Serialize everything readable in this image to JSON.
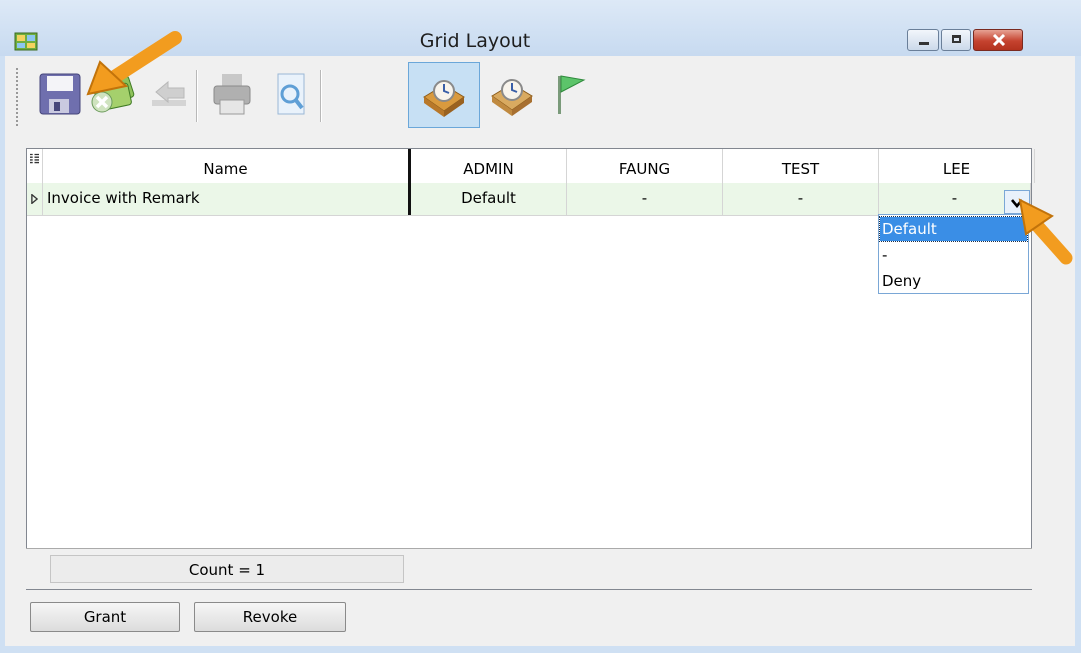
{
  "window": {
    "title": "Grid Layout",
    "controls": [
      "minimize",
      "maximize",
      "close"
    ]
  },
  "toolbar": {
    "buttons": [
      {
        "name": "save",
        "icon": "floppy-disk-icon"
      },
      {
        "name": "cancel",
        "icon": "cancel-money-icon"
      },
      {
        "name": "undo",
        "icon": "undo-icon"
      },
      {
        "name": "print",
        "icon": "printer-icon"
      },
      {
        "name": "preview",
        "icon": "print-preview-icon"
      },
      {
        "name": "grant-layout",
        "icon": "clock-box-icon",
        "pressed": true
      },
      {
        "name": "revoke-layout",
        "icon": "clock-box-icon"
      },
      {
        "name": "flag",
        "icon": "green-flag-icon"
      }
    ]
  },
  "grid": {
    "columns": [
      "Name",
      "ADMIN",
      "FAUNG",
      "TEST",
      "LEE"
    ],
    "rows": [
      {
        "name": "Invoice with Remark",
        "values": [
          "Default",
          "-",
          "-",
          "-"
        ]
      }
    ],
    "footer": {
      "count_label": "Count = 1"
    }
  },
  "dropdown": {
    "options": [
      "Default",
      "-",
      "Deny"
    ],
    "highlighted": "Default"
  },
  "buttons": {
    "grant": "Grant",
    "revoke": "Revoke"
  },
  "colors": {
    "row_highlight": "#ebf7e8",
    "selection": "#3a8ee6",
    "annotation_arrow": "#f29c1f"
  }
}
